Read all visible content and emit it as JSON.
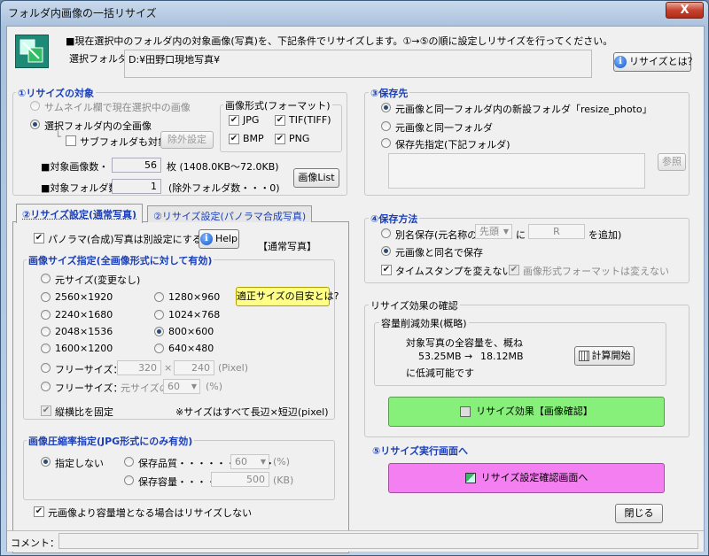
{
  "window": {
    "title": "フォルダ内画像の一括リサイズ",
    "close": "X"
  },
  "header": {
    "description": "■現在選択中のフォルダ内の対象画像(写真)を、下記条件でリサイズします。①→⑤の順に設定しリサイズを行ってください。",
    "folder_label": "選択フォルダ：",
    "folder_value": "D:¥田野口現地写真¥",
    "help_button": "リサイズとは？"
  },
  "target": {
    "title": "①リサイズの対象",
    "opt_thumbnail": "サムネイル欄で現在選択中の画像",
    "opt_all": "選択フォルダ内の全画像",
    "subfolder": "サブフォルダも対象",
    "exclude_button": "除外設定",
    "format_title": "画像形式(フォーマット)",
    "formats": [
      "JPG",
      "TIF(TIFF)",
      "BMP",
      "PNG"
    ],
    "count_label": "■対象画像数・・・",
    "count_value": "56",
    "count_suffix": "枚 (1408.0KB～72.0KB)",
    "folders_label": "■対象フォルダ数・・・",
    "folders_value": "1",
    "folders_suffix": "(除外フォルダ数・・・0)",
    "list_button": "画像List"
  },
  "save": {
    "title": "③保存先",
    "opt_new": "元画像と同一フォルダ内の新設フォルダ「resize_photo」",
    "opt_same": "元画像と同一フォルダ",
    "opt_specify": "保存先指定(下記フォルダ)",
    "browse": "参照"
  },
  "tabs": {
    "normal": "②リサイズ設定(通常写真)",
    "panorama": "②リサイズ設定(パノラマ合成写真)"
  },
  "settings": {
    "panorama_chk": "パノラマ(合成)写真は別設定にする",
    "help": "Help",
    "mode_tag": "【通常写真】",
    "size_title": "画像サイズ指定(全画像形式に対して有効)",
    "size_orig": "元サイズ(変更なし)",
    "sizes": [
      "2560×1920",
      "2240×1680",
      "2048×1536",
      "1600×1200",
      "1280×960",
      "1024×768",
      "800×600",
      "640×480"
    ],
    "tip_button": "適正サイズの目安とは?",
    "free1": "フリーサイズ：",
    "free_w": "320",
    "free_x": "×",
    "free_h": "240",
    "free_unit": "(Pixel)",
    "free2": "フリーサイズ：",
    "free_pct_label": "元サイズの",
    "free_pct": "60",
    "free_pct_unit": "(%)",
    "keep_ratio": "縦横比を固定",
    "note": "※サイズはすべて長辺×短辺(pixel)",
    "comp_title": "画像圧縮率指定(JPG形式にのみ有効)",
    "comp_none": "指定しない",
    "comp_quality": "保存品質・・・・・・・・・・",
    "comp_quality_val": "60",
    "comp_quality_unit": "(%)",
    "comp_size": "保存容量・・・・・・",
    "comp_size_val": "500",
    "comp_size_unit": "(KB)",
    "no_increase": "元画像より容量増となる場合はリサイズしない"
  },
  "method": {
    "title": "④保存方法",
    "opt_rename": "別名保存(元名称の",
    "pos": "先頭",
    "ni": "に",
    "suffix_val": "R",
    "add": "を追加)",
    "opt_same": "元画像と同名で保存",
    "keep_timestamp": "タイムスタンプを変えない",
    "keep_format": "画像形式フォーマットは変えない"
  },
  "effect": {
    "title": "リサイズ効果の確認",
    "sub": "容量削減効果(概略)",
    "line1": "対象写真の全容量を、概ね",
    "before": "53.25MB",
    "arrow": "→",
    "after": "18.12MB",
    "line3": "に低減可能です",
    "calc": "計算開始",
    "preview": "リサイズ効果【画像確認】"
  },
  "execute": {
    "title": "⑤リサイズ実行画面へ",
    "button": "リサイズ設定確認画面へ",
    "close": "閉じる"
  },
  "status": {
    "comment_label": "コメント："
  },
  "colors": {
    "accent": "#1a3fb8",
    "green_button": "#86f07a",
    "pink_button": "#f47ff0"
  }
}
